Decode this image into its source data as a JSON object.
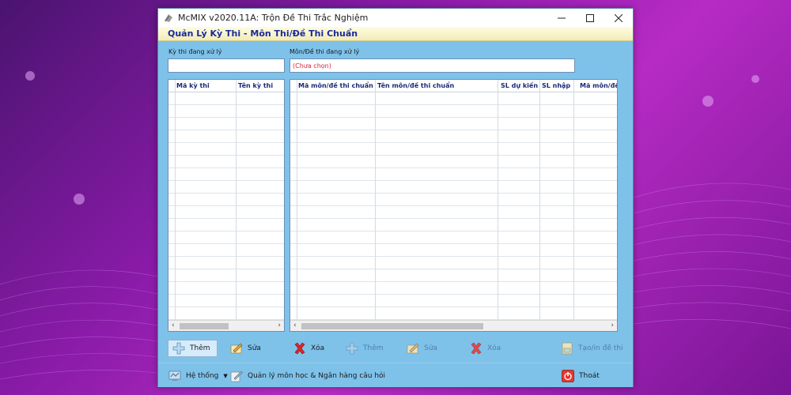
{
  "window": {
    "title": "McMIX v2020.11A: Trộn Đề Thi Trắc Nghiệm",
    "controls": [
      "minimize",
      "maximize",
      "close"
    ]
  },
  "header": {
    "title": "Quản Lý Kỳ Thi - Môn Thi/Đề Thi Chuẩn"
  },
  "exam_panel": {
    "label": "Kỳ thi đang xử lý",
    "value": "",
    "columns": [
      "Mã kỳ thi",
      "Tên kỳ thi"
    ]
  },
  "subject_panel": {
    "label": "Môn/Đề thi đang xử lý",
    "value": "(Chưa chọn)",
    "columns": [
      "Mã môn/đề thi chuẩn",
      "Tên môn/đề thi chuẩn",
      "SL dự kiến",
      "SL nhập",
      "Mã môn/đề"
    ]
  },
  "toolbar": {
    "left": [
      {
        "label": "Thêm",
        "icon": "add-icon",
        "state": "pressed"
      },
      {
        "label": "Sửa",
        "icon": "edit-icon",
        "state": "enabled"
      },
      {
        "label": "Xóa",
        "icon": "delete-icon",
        "state": "enabled"
      }
    ],
    "right": [
      {
        "label": "Thêm",
        "icon": "add-icon",
        "state": "disabled"
      },
      {
        "label": "Sửa",
        "icon": "edit-icon",
        "state": "disabled"
      },
      {
        "label": "Xóa",
        "icon": "delete-icon",
        "state": "disabled"
      },
      {
        "label": "Tạo/in đề thi",
        "icon": "print-icon",
        "state": "disabled"
      }
    ]
  },
  "bottom": {
    "system_label": "Hệ thống",
    "manage_label": "Quản lý môn học & Ngân hàng câu hỏi",
    "exit_label": "Thoát"
  },
  "colors": {
    "window_bg": "#7ec2ea",
    "header_text": "#1a2a9c",
    "placeholder_text": "#e0203a",
    "delete_icon": "#d9262b"
  }
}
